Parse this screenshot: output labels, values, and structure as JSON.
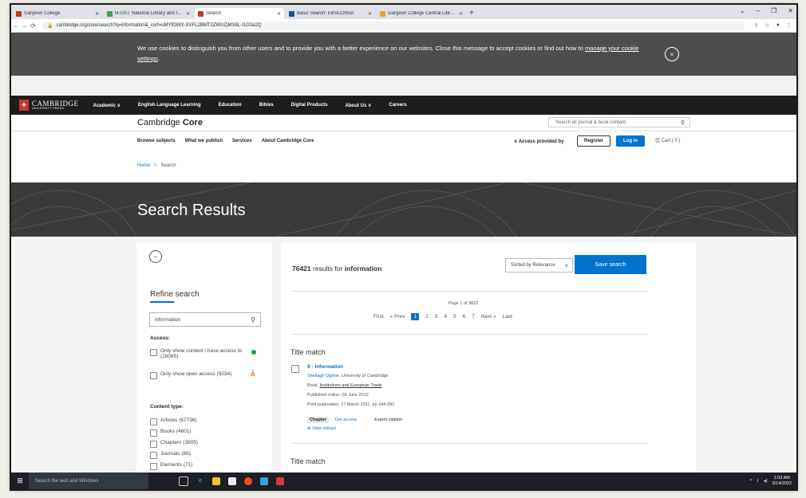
{
  "browser": {
    "tabs": [
      {
        "label": "Gargeon College",
        "color": "#c0392b",
        "active": false
      },
      {
        "label": "N-UST: National Library and Info",
        "color": "#3aa655",
        "active": false
      },
      {
        "label": "Search",
        "color": "#c0392b",
        "active": true
      },
      {
        "label": "Basic Search: EBSCOhost",
        "color": "#1d4f91",
        "active": false
      },
      {
        "label": "Gargeon College Central Library",
        "color": "#e6a81e",
        "active": false
      }
    ],
    "new_tab": "+",
    "url": "cambridge.org/core/search?q=information&_csrf=uMYfOWX-XXFL2BMT2ZWUZjMX6L-t1G3a2Q",
    "window_controls": [
      "⌄",
      "–",
      "❐",
      "✕"
    ]
  },
  "cookie_banner": {
    "text_before": "We use cookies to distinguish you from other users and to provide you with a better experience on our websites. Close this message to accept cookies or find out how to ",
    "link": "manage your cookie settings",
    "text_after": ".",
    "close_glyph": "×"
  },
  "main_nav": {
    "logo_text": "CAMBRIDGE",
    "logo_sub": "UNIVERSITY PRESS",
    "items": [
      "Academic ∨",
      "English Language Learning",
      "Education",
      "Bibles",
      "Digital Products",
      "About Us ∨",
      "Careers"
    ]
  },
  "core_header": {
    "logo_prefix": "Cambridge",
    "logo_bold": "Core",
    "search_placeholder": "Search all journal & book content"
  },
  "sub_nav": {
    "links": [
      "Browse subjects",
      "What we publish",
      "Services",
      "About Cambridge Core"
    ],
    "access": "∨ Access provided by",
    "register": "Register",
    "login": "Log in",
    "cart": "Cart ( 0 )"
  },
  "breadcrumb": {
    "home": "Home",
    "sep": ">",
    "current": "Search"
  },
  "hero": {
    "title": "Search Results"
  },
  "refine": {
    "collapse_glyph": "−",
    "title": "Refine search",
    "input_value": "information",
    "access_title": "Access:",
    "access_options": [
      {
        "label": "Only show content I have access to",
        "count": "(28085)"
      },
      {
        "label": "Only show open access (5034)"
      }
    ],
    "content_type_title": "Content type:",
    "content_types": [
      "Articles (67736)",
      "Books (4601)",
      "Chapters (3905)",
      "Journals (86)",
      "Elements (71)"
    ]
  },
  "results": {
    "count": "76421",
    "count_suffix": " results for ",
    "query": "information",
    "sort_label": "Sorted by Relevance",
    "save_search": "Save search",
    "page_of": "Page 1 of 3822",
    "pager": {
      "first": "First",
      "prev": "« Prev",
      "pages": [
        "1",
        "2",
        "3",
        "4",
        "5",
        "6",
        "7"
      ],
      "next": "Next »",
      "last": "Last"
    },
    "items": [
      {
        "match": "Title match",
        "title": "9 - Information",
        "author": "Shellagh Ogilvie",
        "affiliation": "University of Cambridge",
        "book_prefix": "Book: ",
        "book": "Institutions and European Trade",
        "published_online": "Published online: 05 June 2012",
        "print_publication": "Print publication: 17 March 2011, pp 344-390",
        "chip": "Chapter",
        "get_access": "Get access",
        "export": "Export citation",
        "view_extract": "⊕ View extract"
      }
    ],
    "next_match": "Title match"
  },
  "taskbar": {
    "search_placeholder": "Search the web and Windows",
    "time": "1:03 AM",
    "date": "3/14/2022"
  }
}
